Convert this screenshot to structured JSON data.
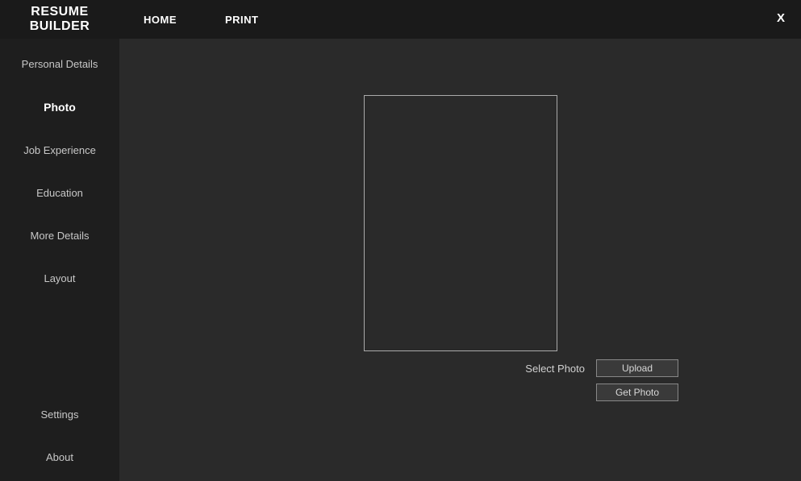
{
  "app": {
    "title_line1": "RESUME",
    "title_line2": "BUILDER"
  },
  "nav": {
    "home": "HOME",
    "print": "PRINT",
    "close": "X"
  },
  "sidebar": {
    "items": [
      {
        "label": "Personal Details",
        "active": false
      },
      {
        "label": "Photo",
        "active": true
      },
      {
        "label": "Job Experience",
        "active": false
      },
      {
        "label": "Education",
        "active": false
      },
      {
        "label": "More Details",
        "active": false
      },
      {
        "label": "Layout",
        "active": false
      }
    ],
    "bottom": [
      {
        "label": "Settings"
      },
      {
        "label": "About"
      }
    ]
  },
  "main": {
    "select_photo_label": "Select Photo",
    "upload_button": "Upload",
    "get_photo_button": "Get Photo"
  }
}
